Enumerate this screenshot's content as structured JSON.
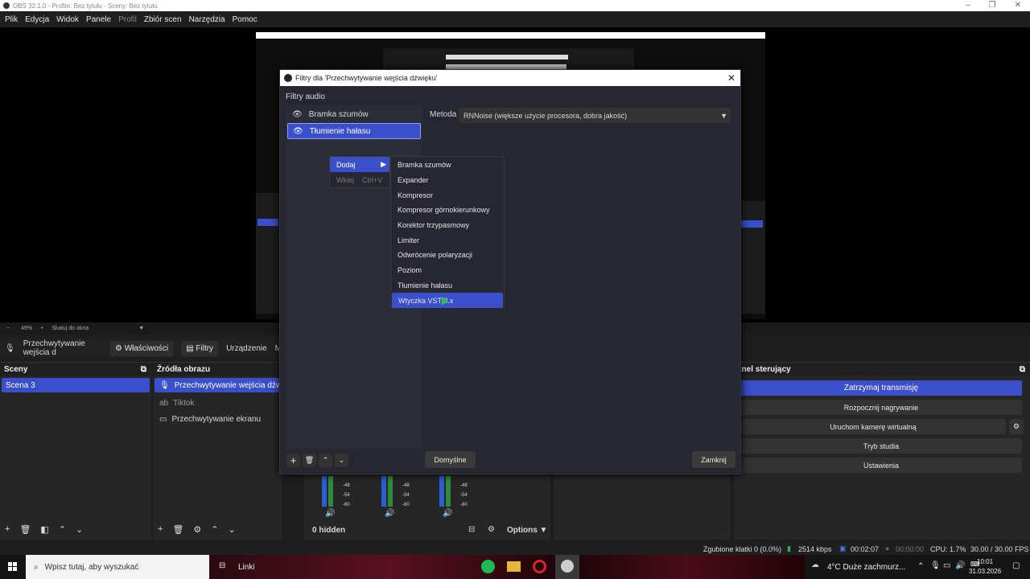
{
  "window": {
    "title": "OBS 32.1.0 - Profile: Bez tytułu - Sceny: Bez tytułu"
  },
  "menubar": {
    "items": [
      "Plik",
      "Edycja",
      "Widok",
      "Panele",
      "Profil",
      "Zbiór scen",
      "Narzędzia",
      "Pomoc"
    ]
  },
  "zoom": {
    "value": "49%",
    "mode": "Skaluj do okna"
  },
  "source_toolbar": {
    "source": "Przechwytywanie wejścia d",
    "properties": "Właściwości",
    "filters": "Filtry",
    "device": "Urządzenie",
    "extra": "M"
  },
  "scenes": {
    "title": "Sceny",
    "items": [
      "Scena 3"
    ]
  },
  "sources": {
    "title": "Źródła obrazu",
    "items": [
      "Przechwytywanie wejścia dźwię",
      "Tiktok",
      "Przechwytywanie ekranu"
    ]
  },
  "mixer": {
    "ticks": [
      "-48",
      "-54",
      "-60"
    ],
    "hidden": "0 hidden",
    "options": "Options"
  },
  "controls": {
    "title": "anel sterujący",
    "buttons": [
      "Zatrzymaj transmisję",
      "Rozpocznij nagrywanie",
      "Uruchom kamerę wirtualną",
      "Tryb studia",
      "Ustawienia"
    ]
  },
  "dialog": {
    "title": "Filtry dla 'Przechwytywanie wejścia dźwięku'",
    "section": "Filtry audio",
    "filters": [
      "Bramka szumów",
      "Tłumienie hałasu"
    ],
    "method_label": "Metoda",
    "method_value": "RNNoise (większe użycie procesora, dobra jakość)",
    "defaults": "Domyślne",
    "close": "Zamknij"
  },
  "context_menu": {
    "add": "Dodaj",
    "paste": "Wklej",
    "paste_shortcut": "Ctrl+V"
  },
  "submenu": {
    "items": [
      "Bramka szumów",
      "Expander",
      "Kompresor",
      "Kompresor górnokierunkowy",
      "Korektor trzypasmowy",
      "Limiter",
      "Odwrócenie polaryzacji",
      "Poziom",
      "Tłumienie hałasu",
      "Wtyczka VST 2.x"
    ]
  },
  "status": {
    "dropped": "Zgubione klatki 0 (0.0%)",
    "bitrate": "2514 kbps",
    "live": "00:02:07",
    "rec": "00:00:00",
    "cpu": "CPU: 1.7%",
    "fps": "30.00 / 30.00 FPS"
  },
  "taskbar": {
    "search": "Wpisz tutaj, aby wyszukać",
    "links": "Linki",
    "weather": "4°C  Duże zachmurz...",
    "time": "10:01",
    "date": "31.03.2026"
  }
}
